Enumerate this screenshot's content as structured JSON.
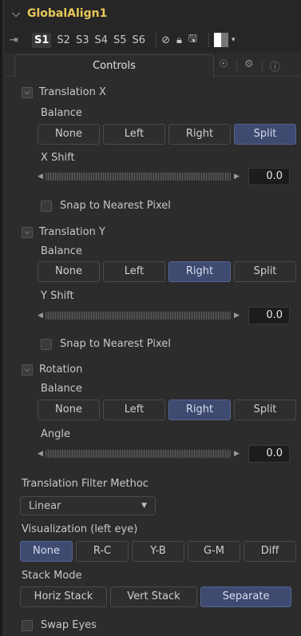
{
  "header": {
    "title": "GlobalAlign1"
  },
  "toolbar": {
    "slots": [
      "S1",
      "S2",
      "S3",
      "S4",
      "S5",
      "S6"
    ],
    "active_slot": "S1"
  },
  "tabs": {
    "controls": "Controls"
  },
  "translation_x": {
    "title": "Translation X",
    "balance_label": "Balance",
    "balance_options": [
      "None",
      "Left",
      "Right",
      "Split"
    ],
    "balance_selected": "Split",
    "shift_label": "X Shift",
    "shift_value": "0.0",
    "snap_label": "Snap to Nearest Pixel",
    "snap_checked": false
  },
  "translation_y": {
    "title": "Translation Y",
    "balance_label": "Balance",
    "balance_options": [
      "None",
      "Left",
      "Right",
      "Split"
    ],
    "balance_selected": "Right",
    "shift_label": "Y Shift",
    "shift_value": "0.0",
    "snap_label": "Snap to Nearest Pixel",
    "snap_checked": false
  },
  "rotation": {
    "title": "Rotation",
    "balance_label": "Balance",
    "balance_options": [
      "None",
      "Left",
      "Right",
      "Split"
    ],
    "balance_selected": "Right",
    "angle_label": "Angle",
    "angle_value": "0.0"
  },
  "filter": {
    "label": "Translation Filter Methoc",
    "value": "Linear"
  },
  "visualization": {
    "label": "Visualization (left eye)",
    "options": [
      "None",
      "R-C",
      "Y-B",
      "G-M",
      "Diff"
    ],
    "selected": "None"
  },
  "stack_mode": {
    "label": "Stack Mode",
    "options": [
      "Horiz Stack",
      "Vert Stack",
      "Separate"
    ],
    "selected": "Separate"
  },
  "swap_eyes": {
    "label": "Swap Eyes",
    "checked": false
  }
}
